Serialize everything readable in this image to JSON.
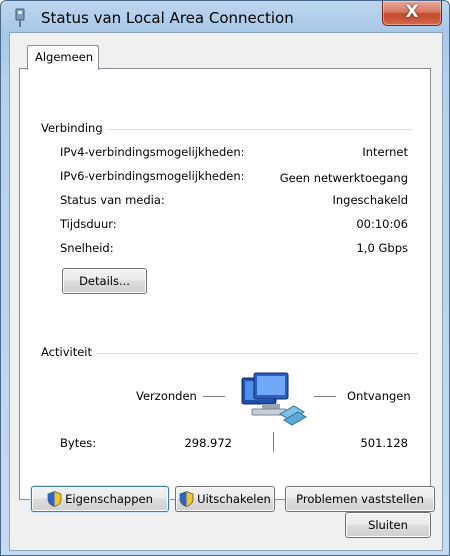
{
  "window": {
    "title": "Status van Local Area Connection",
    "close_symbol": "X"
  },
  "tabs": [
    {
      "label": "Algemeen"
    }
  ],
  "connection": {
    "heading": "Verbinding",
    "rows": [
      {
        "label": "IPv4-verbindingsmogelijkheden:",
        "value": "Internet"
      },
      {
        "label": "IPv6-verbindingsmogelijkheden:",
        "value": "Geen netwerktoegang"
      },
      {
        "label": "Status van media:",
        "value": "Ingeschakeld"
      },
      {
        "label": "Tijdsduur:",
        "value": "00:10:06"
      },
      {
        "label": "Snelheid:",
        "value": "1,0 Gbps"
      }
    ],
    "details_button": "Details..."
  },
  "activity": {
    "heading": "Activiteit",
    "sent_label": "Verzonden",
    "received_label": "Ontvangen",
    "bytes_label": "Bytes:",
    "bytes_sent": "298.972",
    "bytes_received": "501.128"
  },
  "buttons": {
    "properties": "Eigenschappen",
    "disable": "Uitschakelen",
    "diagnose": "Problemen vaststellen",
    "close": "Sluiten"
  },
  "icons": {
    "title": "network-connection-icon",
    "shield": "uac-shield-icon",
    "activity": "network-computers-icon"
  }
}
